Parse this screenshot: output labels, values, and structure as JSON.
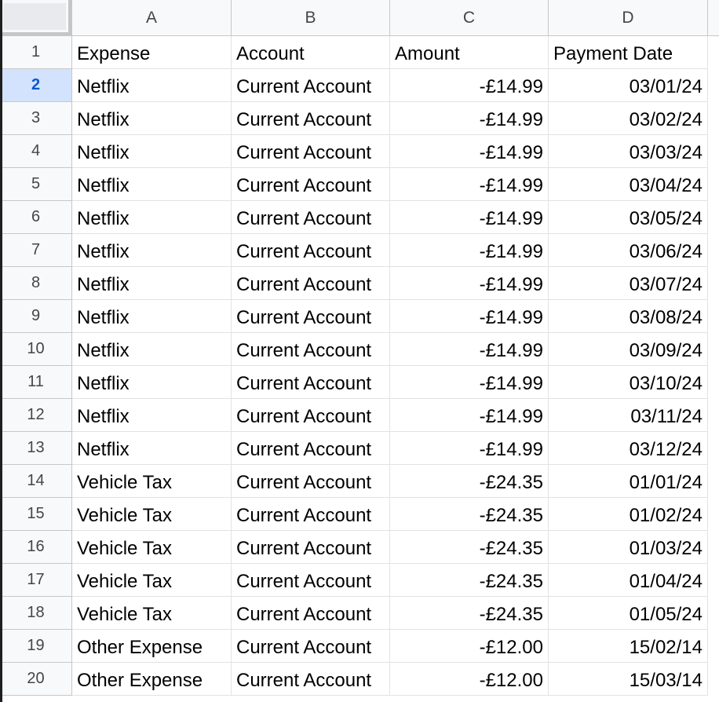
{
  "columns": [
    "A",
    "B",
    "C",
    "D"
  ],
  "active_row": "2",
  "rows": [
    {
      "num": "1",
      "cells": [
        "Expense",
        "Account",
        "Amount",
        "Payment Date"
      ]
    },
    {
      "num": "2",
      "cells": [
        "Netflix",
        "Current Account",
        "-£14.99",
        "03/01/24"
      ]
    },
    {
      "num": "3",
      "cells": [
        "Netflix",
        "Current Account",
        "-£14.99",
        "03/02/24"
      ]
    },
    {
      "num": "4",
      "cells": [
        "Netflix",
        "Current Account",
        "-£14.99",
        "03/03/24"
      ]
    },
    {
      "num": "5",
      "cells": [
        "Netflix",
        "Current Account",
        "-£14.99",
        "03/04/24"
      ]
    },
    {
      "num": "6",
      "cells": [
        "Netflix",
        "Current Account",
        "-£14.99",
        "03/05/24"
      ]
    },
    {
      "num": "7",
      "cells": [
        "Netflix",
        "Current Account",
        "-£14.99",
        "03/06/24"
      ]
    },
    {
      "num": "8",
      "cells": [
        "Netflix",
        "Current Account",
        "-£14.99",
        "03/07/24"
      ]
    },
    {
      "num": "9",
      "cells": [
        "Netflix",
        "Current Account",
        "-£14.99",
        "03/08/24"
      ]
    },
    {
      "num": "10",
      "cells": [
        "Netflix",
        "Current Account",
        "-£14.99",
        "03/09/24"
      ]
    },
    {
      "num": "11",
      "cells": [
        "Netflix",
        "Current Account",
        "-£14.99",
        "03/10/24"
      ]
    },
    {
      "num": "12",
      "cells": [
        "Netflix",
        "Current Account",
        "-£14.99",
        "03/11/24"
      ]
    },
    {
      "num": "13",
      "cells": [
        "Netflix",
        "Current Account",
        "-£14.99",
        "03/12/24"
      ]
    },
    {
      "num": "14",
      "cells": [
        "Vehicle Tax",
        "Current Account",
        "-£24.35",
        "01/01/24"
      ]
    },
    {
      "num": "15",
      "cells": [
        "Vehicle Tax",
        "Current Account",
        "-£24.35",
        "01/02/24"
      ]
    },
    {
      "num": "16",
      "cells": [
        "Vehicle Tax",
        "Current Account",
        "-£24.35",
        "01/03/24"
      ]
    },
    {
      "num": "17",
      "cells": [
        "Vehicle Tax",
        "Current Account",
        "-£24.35",
        "01/04/24"
      ]
    },
    {
      "num": "18",
      "cells": [
        "Vehicle Tax",
        "Current Account",
        "-£24.35",
        "01/05/24"
      ]
    },
    {
      "num": "19",
      "cells": [
        "Other Expense",
        "Current Account",
        "-£12.00",
        "15/02/14"
      ]
    },
    {
      "num": "20",
      "cells": [
        "Other Expense",
        "Current Account",
        "-£12.00",
        "15/03/14"
      ]
    }
  ]
}
